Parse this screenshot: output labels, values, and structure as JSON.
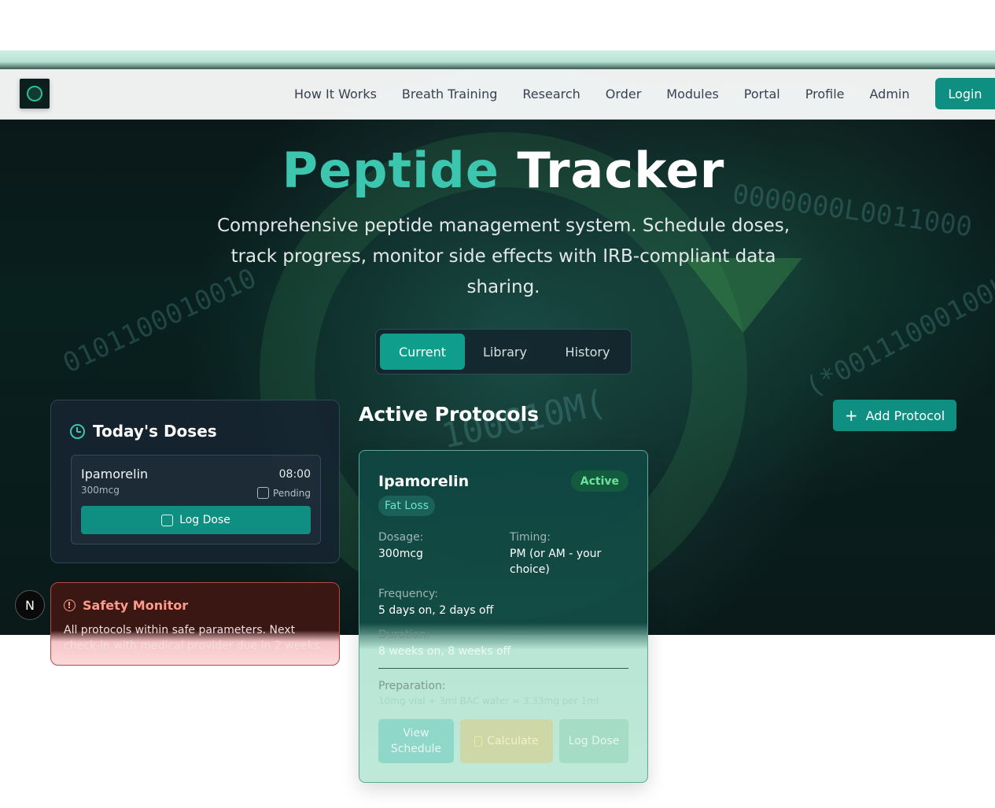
{
  "nav": {
    "links": [
      "How It Works",
      "Breath Training",
      "Research",
      "Order",
      "Modules",
      "Portal",
      "Profile",
      "Admin"
    ],
    "login_label": "Login"
  },
  "hero": {
    "title_accent": "Peptide",
    "title_rest": "Tracker",
    "subtitle": "Comprehensive peptide management system. Schedule doses, track progress, monitor side effects with IRB-compliant data sharing."
  },
  "tabs": [
    {
      "label": "Current",
      "active": true
    },
    {
      "label": "Library",
      "active": false
    },
    {
      "label": "History",
      "active": false
    }
  ],
  "todays_doses": {
    "title": "Today's Doses",
    "items": [
      {
        "name": "Ipamorelin",
        "amount": "300mcg",
        "time": "08:00",
        "status": "Pending",
        "button_label": "Log Dose"
      }
    ]
  },
  "safety": {
    "title": "Safety Monitor",
    "text": "All protocols within safe parameters. Next check-in with medical provider due in 2 weeks."
  },
  "avatar_letter": "N",
  "protocols": {
    "section_title": "Active Protocols",
    "add_label": "Add Protocol",
    "cards": [
      {
        "name": "Ipamorelin",
        "status": "Active",
        "tag": "Fat Loss",
        "dosage_label": "Dosage:",
        "dosage": "300mcg",
        "timing_label": "Timing:",
        "timing": "PM (or AM - your choice)",
        "frequency_label": "Frequency:",
        "frequency": "5 days on, 2 days off",
        "duration_label": "Duration:",
        "duration": "8 weeks on, 8 weeks off",
        "preparation_label": "Preparation:",
        "preparation": "10mg vial + 3ml BAC water = 3.33mg per 1ml",
        "buttons": [
          "View Schedule",
          "Calculate",
          "Log Dose"
        ]
      }
    ]
  },
  "colors": {
    "accent": "#0f8f82",
    "title_accent": "#3cc6b0",
    "active_green": "#6ee29a",
    "safety_red": "#ff9a8a"
  }
}
